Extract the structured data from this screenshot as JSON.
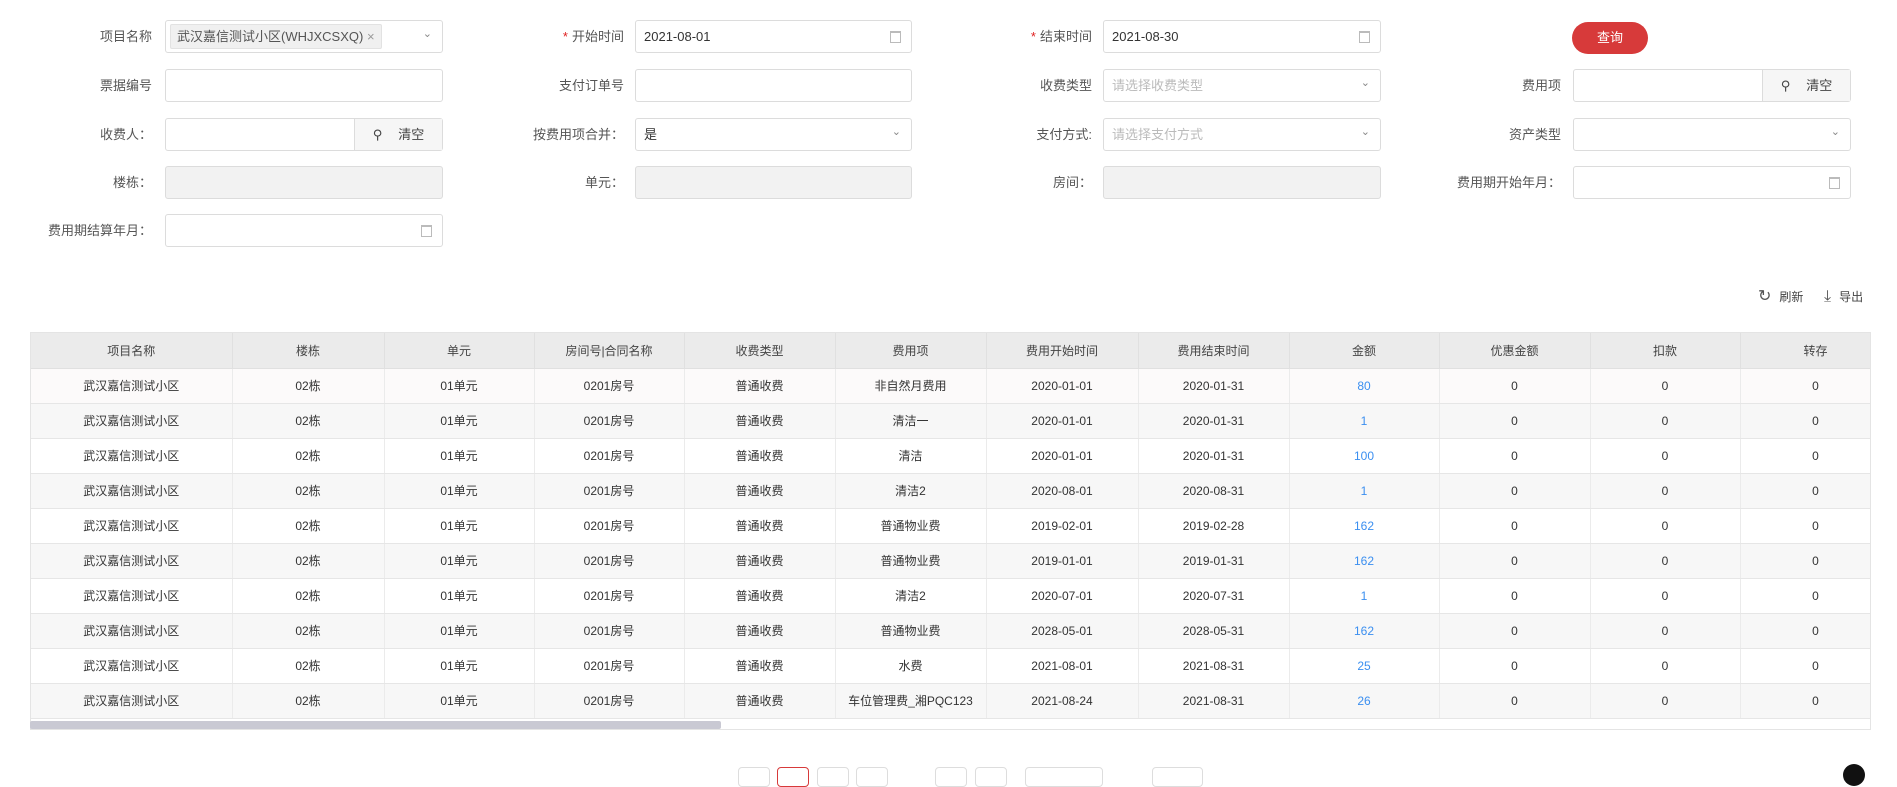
{
  "form": {
    "project_label": "项目名称",
    "project_tag": "武汉嘉信测试小区(WHJXCSXQ)",
    "tag_close": "×",
    "start_label": "开始时间",
    "start_value": "2021-08-01",
    "end_label": "结束时间",
    "end_value": "2021-08-30",
    "query_button": "查询",
    "receipt_label": "票据编号",
    "order_label": "支付订单号",
    "charge_type_label": "收费类型",
    "charge_type_placeholder": "请选择收费类型",
    "fee_item_label": "费用项",
    "clear": "清空",
    "search_icon": "⚲",
    "payee_label": "收费人：",
    "merge_label": "按费用项合并：",
    "merge_value": "是",
    "pay_method_label": "支付方式:",
    "pay_method_placeholder": "请选择支付方式",
    "asset_type_label": "资产类型",
    "building_label": "楼栋：",
    "unit_label": "单元：",
    "room_label": "房间：",
    "period_start_label": "费用期开始年月：",
    "period_settle_label": "费用期结算年月：",
    "required_mark": "*",
    "chevron": "⌄"
  },
  "toolbar": {
    "refresh": "刷新",
    "export": "导出",
    "refresh_icon": "↻",
    "export_icon": "⤓"
  },
  "table": {
    "headers": [
      "项目名称",
      "楼栋",
      "单元",
      "房间号|合同名称",
      "收费类型",
      "费用项",
      "费用开始时间",
      "费用结束时间",
      "金额",
      "优惠金额",
      "扣款",
      "转存"
    ],
    "rows": [
      [
        "武汉嘉信测试小区",
        "02栋",
        "01单元",
        "0201房号",
        "普通收费",
        "非自然月费用",
        "2020-01-01",
        "2020-01-31",
        "80",
        "0",
        "0",
        "0"
      ],
      [
        "武汉嘉信测试小区",
        "02栋",
        "01单元",
        "0201房号",
        "普通收费",
        "清洁一",
        "2020-01-01",
        "2020-01-31",
        "1",
        "0",
        "0",
        "0"
      ],
      [
        "武汉嘉信测试小区",
        "02栋",
        "01单元",
        "0201房号",
        "普通收费",
        "清洁",
        "2020-01-01",
        "2020-01-31",
        "100",
        "0",
        "0",
        "0"
      ],
      [
        "武汉嘉信测试小区",
        "02栋",
        "01单元",
        "0201房号",
        "普通收费",
        "清洁2",
        "2020-08-01",
        "2020-08-31",
        "1",
        "0",
        "0",
        "0"
      ],
      [
        "武汉嘉信测试小区",
        "02栋",
        "01单元",
        "0201房号",
        "普通收费",
        "普通物业费",
        "2019-02-01",
        "2019-02-28",
        "162",
        "0",
        "0",
        "0"
      ],
      [
        "武汉嘉信测试小区",
        "02栋",
        "01单元",
        "0201房号",
        "普通收费",
        "普通物业费",
        "2019-01-01",
        "2019-01-31",
        "162",
        "0",
        "0",
        "0"
      ],
      [
        "武汉嘉信测试小区",
        "02栋",
        "01单元",
        "0201房号",
        "普通收费",
        "清洁2",
        "2020-07-01",
        "2020-07-31",
        "1",
        "0",
        "0",
        "0"
      ],
      [
        "武汉嘉信测试小区",
        "02栋",
        "01单元",
        "0201房号",
        "普通收费",
        "普通物业费",
        "2028-05-01",
        "2028-05-31",
        "162",
        "0",
        "0",
        "0"
      ],
      [
        "武汉嘉信测试小区",
        "02栋",
        "01单元",
        "0201房号",
        "普通收费",
        "水费",
        "2021-08-01",
        "2021-08-31",
        "25",
        "0",
        "0",
        "0"
      ],
      [
        "武汉嘉信测试小区",
        "02栋",
        "01单元",
        "0201房号",
        "普通收费",
        "车位管理费_湘PQC123",
        "2021-08-24",
        "2021-08-31",
        "26",
        "0",
        "0",
        "0"
      ]
    ]
  },
  "colors": {
    "accent": "#d73a3a",
    "link": "#3b8ff0"
  }
}
